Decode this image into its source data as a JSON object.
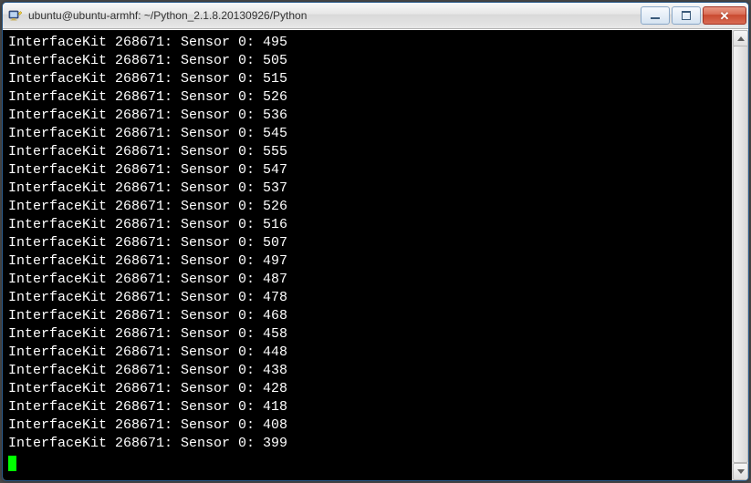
{
  "window": {
    "title": "ubuntu@ubuntu-armhf: ~/Python_2.1.8.20130926/Python"
  },
  "terminal": {
    "device_label": "InterfaceKit",
    "device_id": "268671",
    "sensor_label": "Sensor",
    "sensor_index": "0",
    "lines": [
      {
        "value": "495"
      },
      {
        "value": "505"
      },
      {
        "value": "515"
      },
      {
        "value": "526"
      },
      {
        "value": "536"
      },
      {
        "value": "545"
      },
      {
        "value": "555"
      },
      {
        "value": "547"
      },
      {
        "value": "537"
      },
      {
        "value": "526"
      },
      {
        "value": "516"
      },
      {
        "value": "507"
      },
      {
        "value": "497"
      },
      {
        "value": "487"
      },
      {
        "value": "478"
      },
      {
        "value": "468"
      },
      {
        "value": "458"
      },
      {
        "value": "448"
      },
      {
        "value": "438"
      },
      {
        "value": "428"
      },
      {
        "value": "418"
      },
      {
        "value": "408"
      },
      {
        "value": "399"
      }
    ]
  }
}
